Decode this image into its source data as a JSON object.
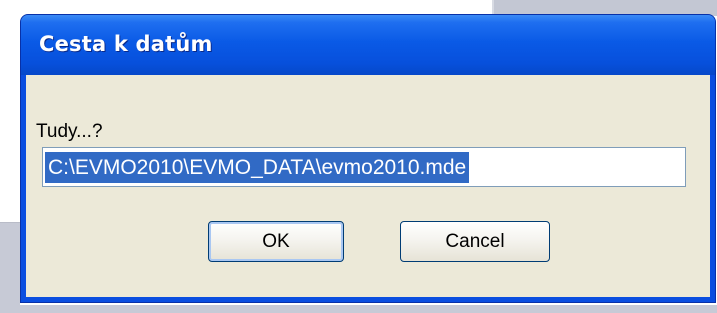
{
  "dialog": {
    "title": "Cesta k datům",
    "prompt": "Tudy...?",
    "path_value": "C:\\EVMO2010\\EVMO_DATA\\evmo2010.mde",
    "ok_label": "OK",
    "cancel_label": "Cancel"
  },
  "colors": {
    "titlebar": "#0a5ae6",
    "dialog_face": "#ece9d8",
    "selection": "#316ac5"
  }
}
